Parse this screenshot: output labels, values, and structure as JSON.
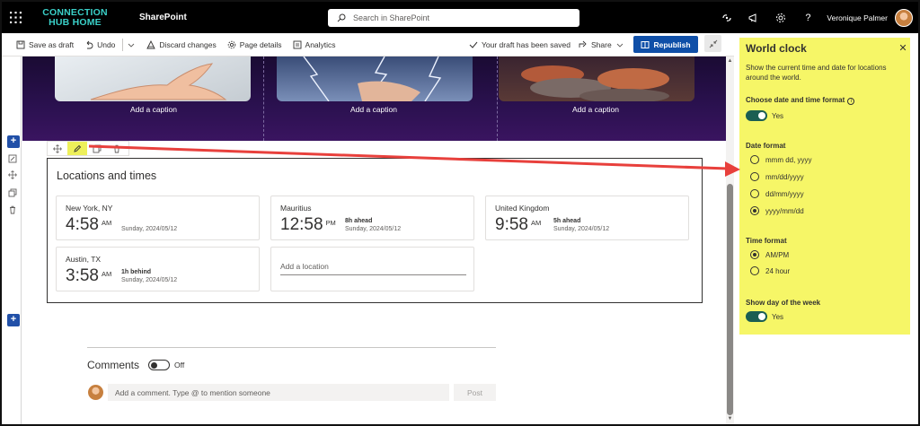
{
  "suite": {
    "brand_line1": "CONNECTION",
    "brand_line2": "HUB HOME",
    "app_name": "SharePoint",
    "search_placeholder": "Search in SharePoint",
    "user_name": "Veronique Palmer",
    "icons": [
      "waffle-icon",
      "search-icon",
      "connections-icon",
      "megaphone-icon",
      "settings-icon",
      "help-icon"
    ]
  },
  "commandbar": {
    "save_draft": "Save as draft",
    "undo": "Undo",
    "discard": "Discard changes",
    "page_details": "Page details",
    "analytics": "Analytics",
    "draft_status": "Your draft has been saved",
    "share": "Share",
    "republish": "Republish"
  },
  "hero": {
    "captions": [
      "Add a caption",
      "Add a caption",
      "Add a caption"
    ]
  },
  "webpart": {
    "title": "Locations and times",
    "clocks": [
      {
        "city": "New York, NY",
        "time": "4:58",
        "ampm": "AM",
        "diff": "",
        "date": "Sunday, 2024/05/12"
      },
      {
        "city": "Mauritius",
        "time": "12:58",
        "ampm": "PM",
        "diff": "8h ahead",
        "date": "Sunday, 2024/05/12"
      },
      {
        "city": "United Kingdom",
        "time": "9:58",
        "ampm": "AM",
        "diff": "5h ahead",
        "date": "Sunday, 2024/05/12"
      },
      {
        "city": "Austin, TX",
        "time": "3:58",
        "ampm": "AM",
        "diff": "1h behind",
        "date": "Sunday, 2024/05/12"
      }
    ],
    "add_location_placeholder": "Add a location"
  },
  "comments": {
    "title": "Comments",
    "toggle_state": "Off",
    "input_placeholder": "Add a comment. Type @ to mention someone",
    "post": "Post"
  },
  "pane": {
    "title": "World clock",
    "description": "Show the current time and date for locations around the world.",
    "format_label": "Choose date and time format",
    "format_toggle": "Yes",
    "date_format_label": "Date format",
    "date_formats": [
      "mmm dd, yyyy",
      "mm/dd/yyyy",
      "dd/mm/yyyy",
      "yyyy/mm/dd"
    ],
    "date_format_selected": 3,
    "time_format_label": "Time format",
    "time_formats": [
      "AM/PM",
      "24 hour"
    ],
    "time_format_selected": 0,
    "day_of_week_label": "Show day of the week",
    "day_of_week_toggle": "Yes"
  },
  "colors": {
    "brand_teal": "#3ad0c8",
    "republish_blue": "#0f4fa8",
    "highlight_yellow": "#f6f667",
    "toggle_green": "#1b5e52",
    "annotation_red": "#e8403c"
  }
}
